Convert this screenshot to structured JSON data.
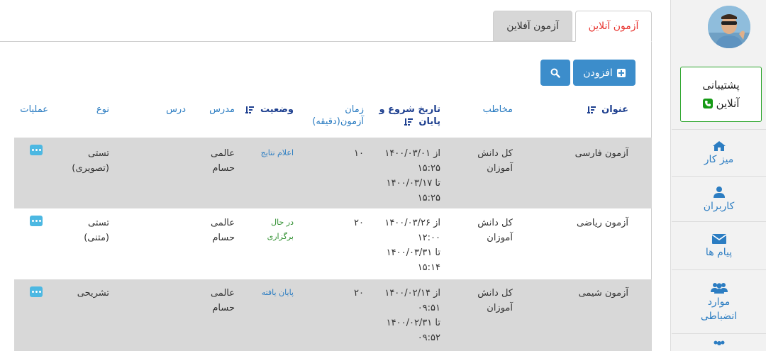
{
  "tabs": {
    "online": "آزمون آنلاین",
    "offline": "آزمون آفلاین"
  },
  "toolbar": {
    "add_label": "افزودن"
  },
  "sidebar": {
    "support_line1": "پشتیبانی",
    "support_line2": "آنلاین",
    "items": [
      {
        "label": "میز کار",
        "icon": "home-icon"
      },
      {
        "label": "کاربران",
        "icon": "user-icon"
      },
      {
        "label": "پیام ها",
        "icon": "envelope-icon"
      },
      {
        "label1": "موارد",
        "label2": "انضباطی",
        "icon": "users-icon"
      }
    ]
  },
  "table": {
    "headers": {
      "title": "عنوان",
      "audience": "مخاطب",
      "dates_line1": "تاریخ شروع و",
      "dates_line2": "پایان",
      "duration_line1": "زمان",
      "duration_line2": "آزمون(دقیقه)",
      "status": "وضعیت",
      "teacher": "مدرس",
      "lesson": "درس",
      "type": "نوع",
      "actions": "عملیات"
    },
    "rows": [
      {
        "title": "آزمون فارسی",
        "audience1": "کل دانش",
        "audience2": "آموزان",
        "from_date": "از ۱۴۰۰/۰۳/۰۱",
        "from_time": "۱۵:۲۵",
        "to_date": "تا ۱۴۰۰/۰۳/۱۷",
        "to_time": "۱۵:۲۵",
        "duration": "۱۰",
        "status1": "اعلام نتایج",
        "status2": "",
        "teacher1": "عالمی",
        "teacher2": "حسام",
        "type1": "تستی",
        "type2": "(تصویری)"
      },
      {
        "title": "آزمون ریاضی",
        "audience1": "کل دانش",
        "audience2": "آموزان",
        "from_date": "از ۱۴۰۰/۰۳/۲۶",
        "from_time": "۱۲:۰۰",
        "to_date": "تا ۱۴۰۰/۰۳/۳۱",
        "to_time": "۱۵:۱۴",
        "duration": "۲۰",
        "status1": "در حال",
        "status2": "برگزاری",
        "teacher1": "عالمی",
        "teacher2": "حسام",
        "type1": "تستی",
        "type2": "(متنی)"
      },
      {
        "title": "آزمون شیمی",
        "audience1": "کل دانش",
        "audience2": "آموزان",
        "from_date": "از ۱۴۰۰/۰۲/۱۴",
        "from_time": "۰۹:۵۱",
        "to_date": "تا ۱۴۰۰/۰۲/۳۱",
        "to_time": "۰۹:۵۲",
        "duration": "۲۰",
        "status1": "پایان یافته",
        "status2": "",
        "teacher1": "عالمی",
        "teacher2": "حسام",
        "type1": "تشریحی",
        "type2": ""
      }
    ]
  },
  "colors": {
    "accent": "#3c8dcb",
    "active_tab_text": "#e8322d",
    "support_border": "#2ca52c",
    "ops_button": "#4cb8e2",
    "row_gray": "#d8d8d8"
  }
}
